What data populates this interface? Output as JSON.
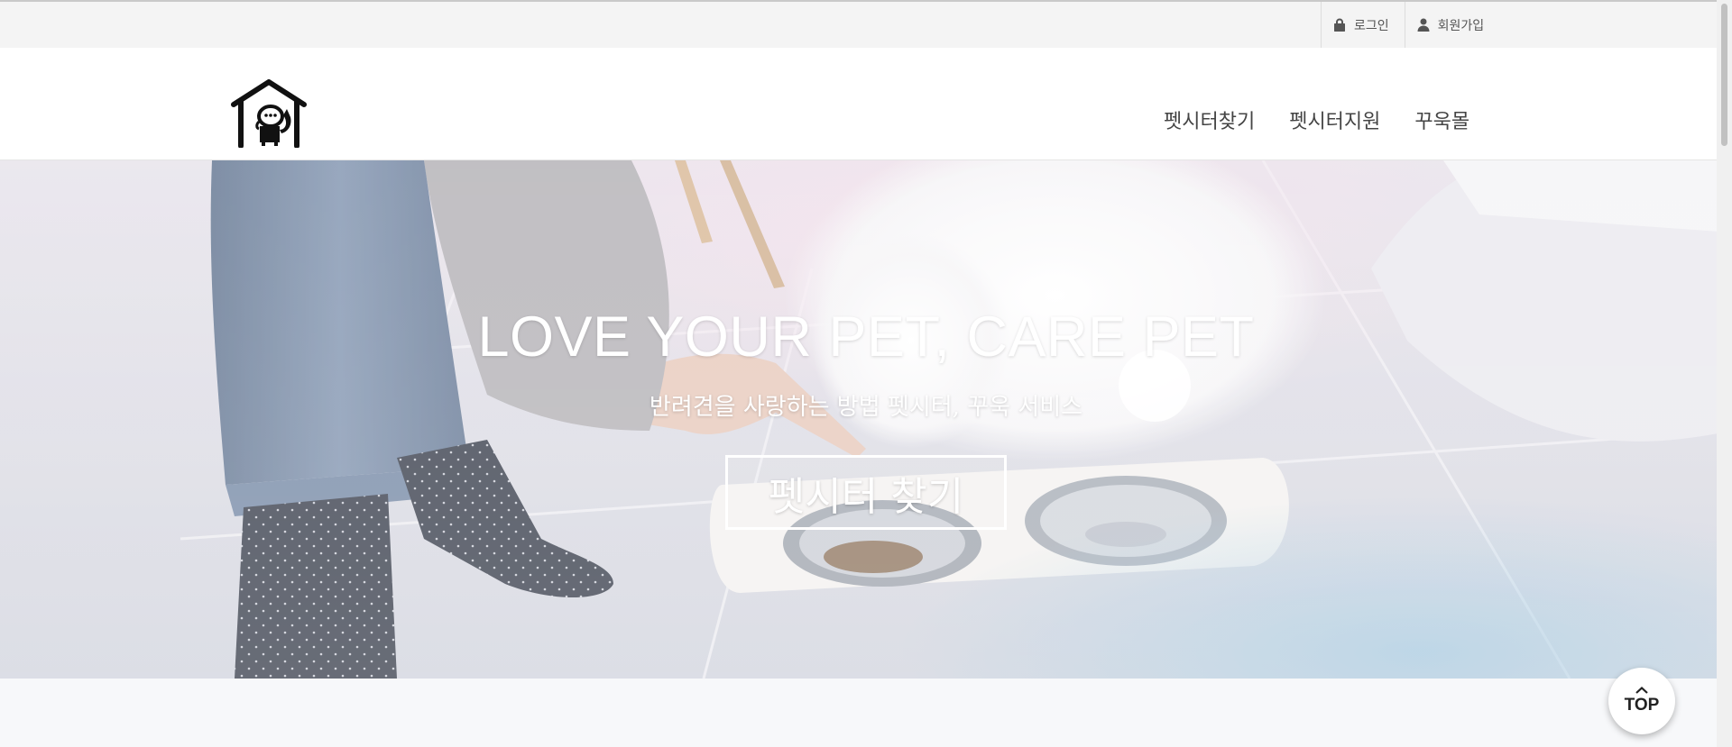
{
  "topbar": {
    "login_label": "로그인",
    "login_icon": "lock-icon",
    "signup_label": "회원가입",
    "signup_icon": "user-icon"
  },
  "header": {
    "logo_icon": "house-with-dog-icon",
    "nav": [
      {
        "label": "펫시터찾기"
      },
      {
        "label": "펫시터지원"
      },
      {
        "label": "꾸욱몰"
      }
    ]
  },
  "hero": {
    "title": "LOVE YOUR PET, CARE PET",
    "subtitle": "반려견을 사랑하는 방법 펫시터, 꾸욱 서비스",
    "cta_label": "펫시터 찾기",
    "background": "photo-dog-eating-from-bowls"
  },
  "top_button": {
    "label": "TOP",
    "icon": "chevron-up-icon"
  },
  "colors": {
    "topbar_bg": "#f4f4f4",
    "nav_text": "#444444",
    "hero_text": "#ffffff"
  }
}
